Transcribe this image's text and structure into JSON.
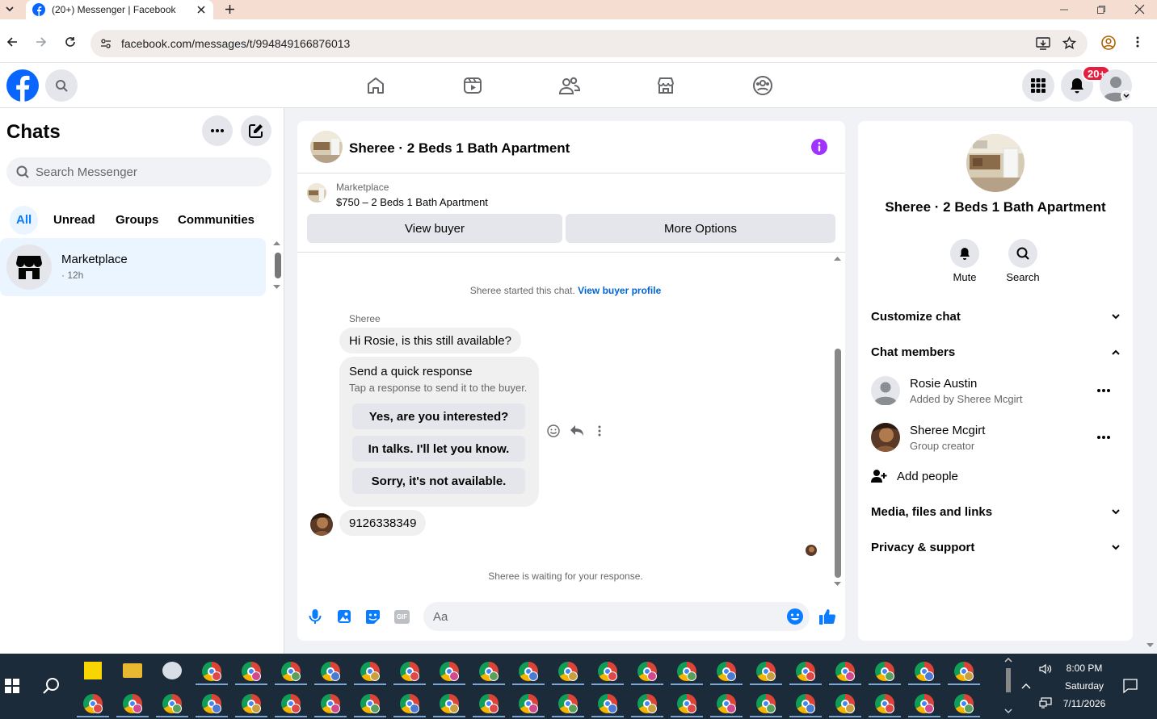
{
  "browser": {
    "tab_title": "(20+) Messenger | Facebook",
    "url": "facebook.com/messages/t/994849166876013"
  },
  "header": {
    "notification_badge": "20+"
  },
  "sidebar": {
    "title": "Chats",
    "search_placeholder": "Search Messenger",
    "filters": [
      "All",
      "Unread",
      "Groups",
      "Communities"
    ],
    "chat": {
      "name": "Marketplace",
      "time": "· 12h"
    }
  },
  "conversation": {
    "title": "Sheree · 2 Beds 1 Bath Apartment",
    "listing": {
      "label": "Marketplace",
      "title": "$750 – 2 Beds 1 Bath Apartment"
    },
    "buttons": {
      "view_buyer": "View buyer",
      "more_options": "More Options"
    },
    "started_text": "Sheree started this chat.",
    "started_link": "View buyer profile",
    "sender_name": "Sheree",
    "message_1": "Hi Rosie, is this still available?",
    "quick": {
      "title": "Send a quick response",
      "subtitle": "Tap a response to send it to the buyer.",
      "options": [
        "Yes, are you interested?",
        "In talks. I'll let you know.",
        "Sorry, it's not available."
      ]
    },
    "message_2": "9126338349",
    "waiting_text": "Sheree is waiting for your response.",
    "composer_placeholder": "Aa"
  },
  "info": {
    "title": "Sheree · 2 Beds 1 Bath Apartment",
    "actions": {
      "mute": "Mute",
      "search": "Search"
    },
    "sections": {
      "customize": "Customize chat",
      "members": "Chat members",
      "media": "Media, files and links",
      "privacy": "Privacy & support"
    },
    "members": [
      {
        "name": "Rosie Austin",
        "sub": "Added by Sheree Mcgirt"
      },
      {
        "name": "Sheree Mcgirt",
        "sub": "Group creator"
      }
    ],
    "add_people": "Add people"
  },
  "taskbar": {
    "time": "8:00 PM",
    "day": "Saturday",
    "date": "7/11/2026"
  },
  "colors": {
    "fb_blue": "#0866ff",
    "messenger_blue": "#0a7cff",
    "info_purple": "#a033ff",
    "badge_red": "#e41e3f"
  }
}
